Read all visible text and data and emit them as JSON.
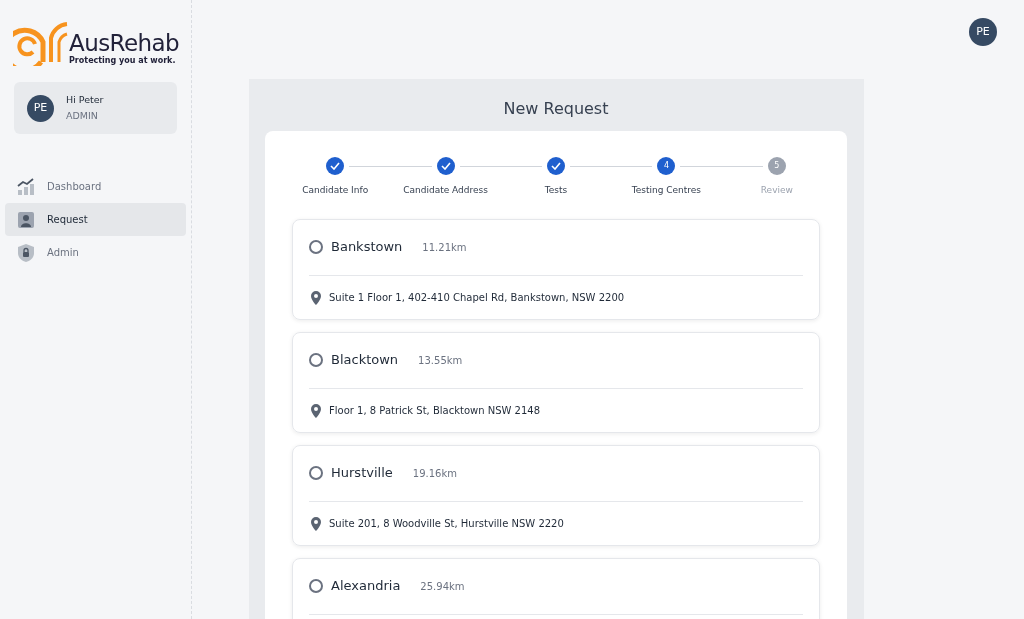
{
  "logo": {
    "name": "AusRehab",
    "tagline": "Protecting you at work."
  },
  "user": {
    "initials": "PE",
    "greeting": "Hi Peter",
    "role": "ADMIN"
  },
  "nav": [
    {
      "label": "Dashboard",
      "kind": "chart",
      "selected": false
    },
    {
      "label": "Request",
      "kind": "person",
      "selected": true
    },
    {
      "label": "Admin",
      "kind": "lock",
      "selected": false
    }
  ],
  "header_avatar": "PE",
  "title": "New Request",
  "steps": [
    {
      "label": "Candidate Info",
      "kind": "done"
    },
    {
      "label": "Candidate Address",
      "kind": "done"
    },
    {
      "label": "Tests",
      "kind": "done"
    },
    {
      "label": "Testing Centres",
      "kind": "current",
      "number": "4"
    },
    {
      "label": "Review",
      "kind": "upcoming",
      "number": "5"
    }
  ],
  "centres": [
    {
      "name": "Bankstown",
      "distance": "11.21km",
      "address": "Suite 1 Floor 1, 402-410 Chapel Rd, Bankstown, NSW 2200",
      "selected": false
    },
    {
      "name": "Blacktown",
      "distance": "13.55km",
      "address": "Floor 1, 8 Patrick St, Blacktown NSW 2148",
      "selected": false
    },
    {
      "name": "Hurstville",
      "distance": "19.16km",
      "address": "Suite 201, 8 Woodville St, Hurstville NSW 2220",
      "selected": false
    },
    {
      "name": "Alexandria",
      "distance": "25.94km",
      "selected": false
    }
  ]
}
